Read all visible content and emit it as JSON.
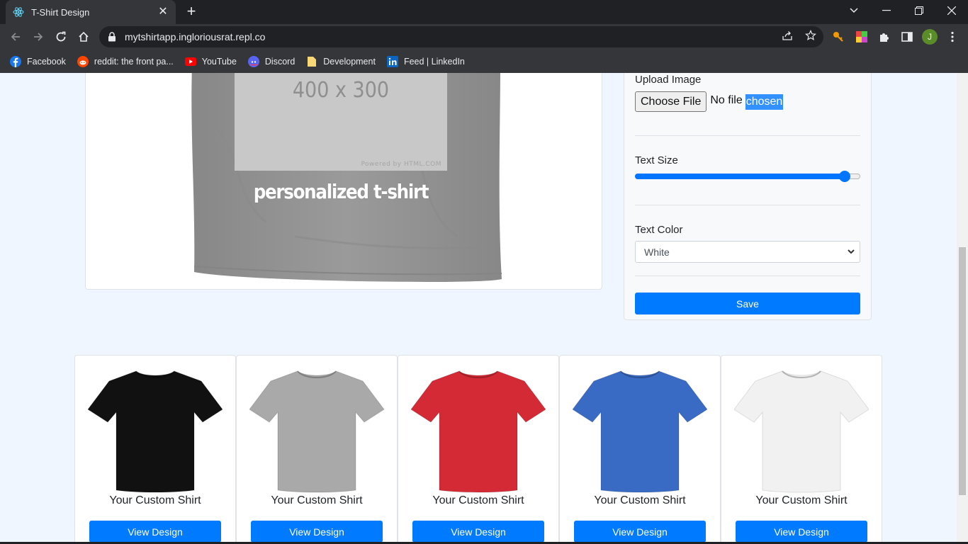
{
  "browser": {
    "tab_title": "T-Shirt Design",
    "url": "mytshirtapp.ingloriousrat.repl.co",
    "profile_initial": "J",
    "bookmarks": [
      {
        "label": "Facebook",
        "icon": "facebook-icon"
      },
      {
        "label": "reddit: the front pa...",
        "icon": "reddit-icon"
      },
      {
        "label": "YouTube",
        "icon": "youtube-icon"
      },
      {
        "label": "Discord",
        "icon": "discord-icon"
      },
      {
        "label": "Development",
        "icon": "folder-icon"
      },
      {
        "label": "Feed | LinkedIn",
        "icon": "linkedin-icon"
      }
    ]
  },
  "preview": {
    "placeholder_size": "400 x 300",
    "placeholder_powered": "Powered by HTML.COM",
    "shirt_text": "personalized t-shirt",
    "shirt_color": "#9a9a9a"
  },
  "controls": {
    "upload_label": "Upload Image",
    "choose_file_label": "Choose File",
    "file_status_plain": "No file",
    "file_status_selected": "chosen",
    "text_size_label": "Text Size",
    "text_size_value": 0.93,
    "text_color_label": "Text Color",
    "text_color_value": "White",
    "save_label": "Save"
  },
  "gallery": [
    {
      "name": "Your Custom Shirt",
      "button": "View Design",
      "color": "#111111"
    },
    {
      "name": "Your Custom Shirt",
      "button": "View Design",
      "color": "#a9a9a9"
    },
    {
      "name": "Your Custom Shirt",
      "button": "View Design",
      "color": "#d42a35"
    },
    {
      "name": "Your Custom Shirt",
      "button": "View Design",
      "color": "#3a6bc4"
    },
    {
      "name": "Your Custom Shirt",
      "button": "View Design",
      "color": "#f1f1f1"
    }
  ],
  "colors": {
    "accent": "#007bff",
    "page_bg": "#f0f6ff"
  }
}
